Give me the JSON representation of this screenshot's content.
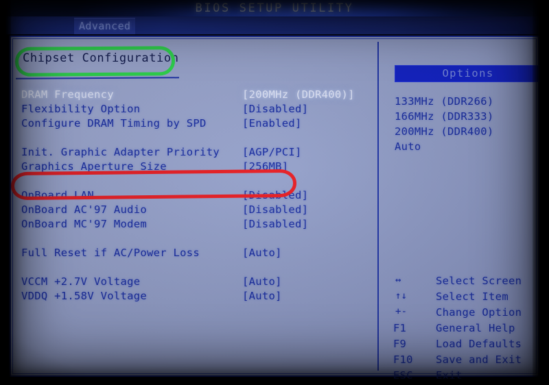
{
  "window": {
    "title": "BIOS SETUP UTILITY"
  },
  "menubar": {
    "tabs": [
      {
        "label": "Advanced",
        "active": true
      }
    ]
  },
  "main": {
    "section_title": "Chipset Configuration",
    "settings": [
      {
        "label": "DRAM Frequency",
        "value": "[200MHz (DDR400)]",
        "selected": true
      },
      {
        "label": "Flexibility Option",
        "value": "[Disabled]",
        "selected": false
      },
      {
        "label": "Configure DRAM Timing by SPD",
        "value": "[Enabled]",
        "selected": false
      },
      {
        "spacer": true
      },
      {
        "label": "Init. Graphic Adapter Priority",
        "value": "[AGP/PCI]",
        "selected": false
      },
      {
        "label": "Graphics Aperture Size",
        "value": "[256MB]",
        "selected": false
      },
      {
        "spacer": true
      },
      {
        "label": "OnBoard LAN",
        "value": "[Disabled]",
        "selected": false
      },
      {
        "label": "OnBoard AC'97 Audio",
        "value": "[Disabled]",
        "selected": false
      },
      {
        "label": "OnBoard MC'97 Modem",
        "value": "[Disabled]",
        "selected": false
      },
      {
        "spacer": true
      },
      {
        "label": "Full Reset if AC/Power Loss",
        "value": "[Auto]",
        "selected": false
      },
      {
        "spacer": true
      },
      {
        "label": "VCCM +2.7V Voltage",
        "value": "[Auto]",
        "selected": false
      },
      {
        "label": "VDDQ +1.58V Voltage",
        "value": "[Auto]",
        "selected": false
      }
    ]
  },
  "options_pane": {
    "header": "Options",
    "items": [
      "133MHz (DDR266)",
      "166MHz (DDR333)",
      "200MHz (DDR400)",
      "Auto"
    ]
  },
  "key_legend": [
    {
      "key": "↔",
      "symbol": true,
      "desc": "Select Screen"
    },
    {
      "key": "↑↓",
      "symbol": true,
      "desc": "Select Item"
    },
    {
      "key": "+-",
      "symbol": true,
      "desc": "Change Option"
    },
    {
      "key": "F1",
      "symbol": false,
      "desc": "General Help"
    },
    {
      "key": "F9",
      "symbol": false,
      "desc": "Load Defaults"
    },
    {
      "key": "F10",
      "symbol": false,
      "desc": "Save and Exit"
    },
    {
      "key": "ESC",
      "symbol": false,
      "desc": "Exit"
    }
  ],
  "annotations": [
    {
      "name": "chipset-configuration-highlight",
      "shape": "ellipse",
      "color": "#31e04a",
      "targets": "Chipset Configuration"
    },
    {
      "name": "graphics-aperture-size-highlight",
      "shape": "ellipse",
      "color": "#ef2020",
      "targets": "Graphics Aperture Size"
    }
  ],
  "colors": {
    "panel_background": "#9ba6cc",
    "panel_border": "#1a2ea8",
    "text_blue": "#1b2ea0",
    "text_selected": "#e9edfb",
    "titlebar_blue": "#2546cf",
    "options_header": "#1423c8",
    "annotation_green": "#31e04a",
    "annotation_red": "#ef2020"
  }
}
